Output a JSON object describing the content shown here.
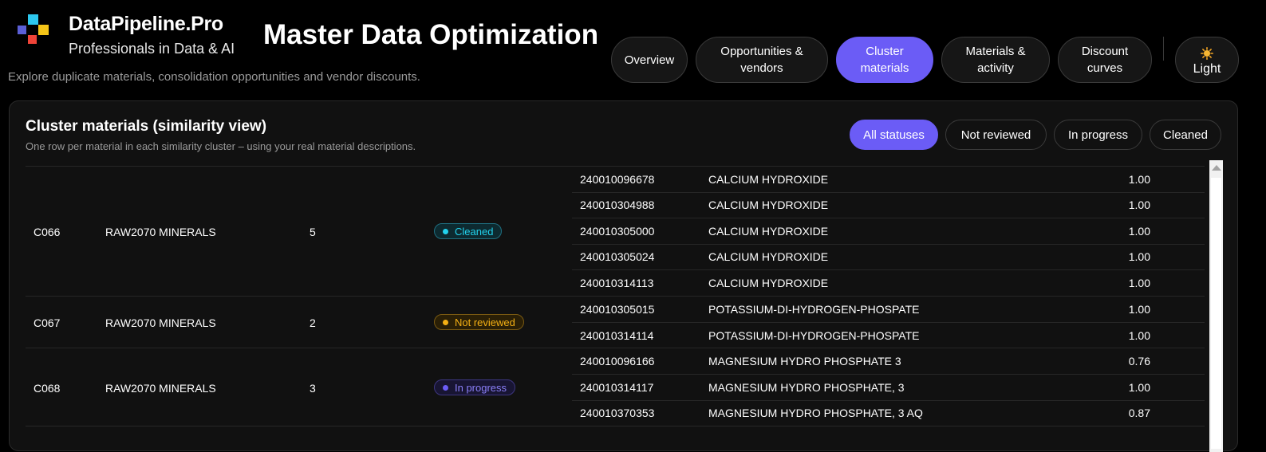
{
  "brand": {
    "name": "DataPipeline.Pro",
    "tagline": "Professionals in Data & AI"
  },
  "page": {
    "title": "Master Data Optimization",
    "subtitle": "Explore duplicate materials, consolidation opportunities and vendor discounts."
  },
  "nav": {
    "items": [
      {
        "line1": "Overview",
        "line2": "",
        "active": false
      },
      {
        "line1": "Opportunities &",
        "line2": "vendors",
        "active": false
      },
      {
        "line1": "Cluster",
        "line2": "materials",
        "active": true
      },
      {
        "line1": "Materials &",
        "line2": "activity",
        "active": false
      },
      {
        "line1": "Discount",
        "line2": "curves",
        "active": false
      }
    ],
    "theme_toggle": {
      "label": "Light",
      "icon": "sun-icon"
    }
  },
  "panel": {
    "title": "Cluster materials (similarity view)",
    "subtitle": "One row per material in each similarity cluster – using your real material descriptions.",
    "filters": [
      {
        "label": "All statuses",
        "active": true
      },
      {
        "label": "Not reviewed",
        "active": false
      },
      {
        "label": "In progress",
        "active": false
      },
      {
        "label": "Cleaned",
        "active": false
      }
    ]
  },
  "clusters": [
    {
      "id": "C066",
      "group": "RAW2070 MINERALS",
      "count": "5",
      "status": "Cleaned",
      "materials": [
        {
          "id": "240010096678",
          "desc": "CALCIUM HYDROXIDE",
          "score": "1.00"
        },
        {
          "id": "240010304988",
          "desc": "CALCIUM HYDROXIDE",
          "score": "1.00"
        },
        {
          "id": "240010305000",
          "desc": "CALCIUM HYDROXIDE",
          "score": "1.00"
        },
        {
          "id": "240010305024",
          "desc": "CALCIUM HYDROXIDE",
          "score": "1.00"
        },
        {
          "id": "240010314113",
          "desc": "CALCIUM HYDROXIDE",
          "score": "1.00"
        }
      ]
    },
    {
      "id": "C067",
      "group": "RAW2070 MINERALS",
      "count": "2",
      "status": "Not reviewed",
      "materials": [
        {
          "id": "240010305015",
          "desc": "POTASSIUM-DI-HYDROGEN-PHOSPATE",
          "score": "1.00"
        },
        {
          "id": "240010314114",
          "desc": "POTASSIUM-DI-HYDROGEN-PHOSPATE",
          "score": "1.00"
        }
      ]
    },
    {
      "id": "C068",
      "group": "RAW2070 MINERALS",
      "count": "3",
      "status": "In progress",
      "materials": [
        {
          "id": "240010096166",
          "desc": "MAGNESIUM HYDRO PHOSPHATE 3",
          "score": "0.76"
        },
        {
          "id": "240010314117",
          "desc": "MAGNESIUM HYDRO PHOSPHATE, 3",
          "score": "1.00"
        },
        {
          "id": "240010370353",
          "desc": "MAGNESIUM HYDRO PHOSPHATE, 3 AQ",
          "score": "0.87"
        }
      ]
    }
  ],
  "status_colors": {
    "Cleaned": "#22d3ee",
    "Not reviewed": "#f5b014",
    "In progress": "#6b5cf6"
  },
  "colors": {
    "accent": "#6b5cf6",
    "background": "#000000",
    "panel": "#111111"
  }
}
